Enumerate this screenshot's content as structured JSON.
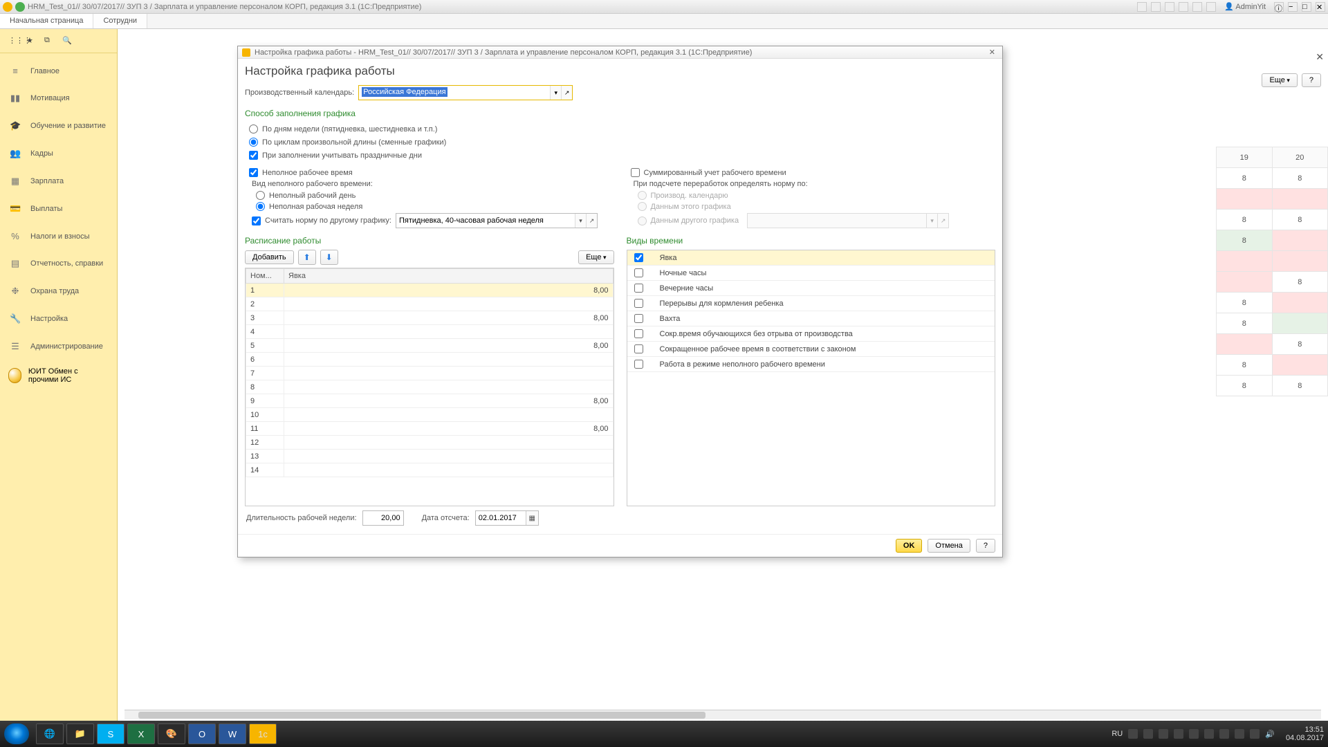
{
  "titlebar": {
    "text": "HRM_Test_01// 30/07/2017// ЗУП 3 / Зарплата и управление персоналом КОРП, редакция 3.1  (1С:Предприятие)",
    "user": "AdminYit"
  },
  "tabs": {
    "t0": "Начальная страница",
    "t1": "Сотрудни"
  },
  "sidebar": {
    "items": [
      "Главное",
      "Мотивация",
      "Обучение и развитие",
      "Кадры",
      "Зарплата",
      "Выплаты",
      "Налоги и взносы",
      "Отчетность, справки",
      "Охрана труда",
      "Настройка",
      "Администрирование"
    ],
    "yuit": "ЮИТ Обмен с прочими ИС"
  },
  "content": {
    "more": "Еще",
    "help": "?"
  },
  "modal": {
    "title": "Настройка графика работы - HRM_Test_01// 30/07/2017// ЗУП 3 / Зарплата и управление персоналом КОРП, редакция 3.1  (1С:Предприятие)",
    "h1": "Настройка графика работы",
    "calendar_label": "Производственный календарь:",
    "calendar_value": "Российская Федерация",
    "sect_fill": "Способ заполнения графика",
    "radio_bydays": "По дням недели (пятидневка, шестидневка и т.п.)",
    "radio_bycycles": "По циклам произвольной длины (сменные графики)",
    "chk_holidays": "При заполнении учитывать праздничные дни",
    "chk_parttime": "Неполное рабочее время",
    "chk_summ": "Суммированный учет рабочего времени",
    "pt_kind_label": "Вид неполного рабочего времени:",
    "pt_kind_day": "Неполный рабочий день",
    "pt_kind_week": "Неполная рабочая неделя",
    "chk_normother": "Считать норму по другому графику:",
    "norm_value": "Пятидневка, 40-часовая рабочая неделя",
    "norm_by_label": "При подсчете переработок определять норму по:",
    "norm_by_cal": "Производ. календарю",
    "norm_by_this": "Данным этого графика",
    "norm_by_other": "Данным другого графика",
    "sect_sched": "Расписание работы",
    "btn_add": "Добавить",
    "btn_more": "Еще",
    "col_num": "Ном...",
    "col_att": "Явка",
    "rows": [
      {
        "n": "1",
        "v": "8,00"
      },
      {
        "n": "2",
        "v": ""
      },
      {
        "n": "3",
        "v": "8,00"
      },
      {
        "n": "4",
        "v": ""
      },
      {
        "n": "5",
        "v": "8,00"
      },
      {
        "n": "6",
        "v": ""
      },
      {
        "n": "7",
        "v": ""
      },
      {
        "n": "8",
        "v": ""
      },
      {
        "n": "9",
        "v": "8,00"
      },
      {
        "n": "10",
        "v": ""
      },
      {
        "n": "11",
        "v": "8,00"
      },
      {
        "n": "12",
        "v": ""
      },
      {
        "n": "13",
        "v": ""
      },
      {
        "n": "14",
        "v": ""
      }
    ],
    "sect_types": "Виды времени",
    "types": [
      {
        "label": "Явка",
        "checked": true
      },
      {
        "label": "Ночные часы",
        "checked": false
      },
      {
        "label": "Вечерние часы",
        "checked": false
      },
      {
        "label": "Перерывы для кормления ребенка",
        "checked": false
      },
      {
        "label": "Вахта",
        "checked": false
      },
      {
        "label": "Сокр.время обучающихся без отрыва от производства",
        "checked": false
      },
      {
        "label": "Сокращенное рабочее время в соответствии с законом",
        "checked": false
      },
      {
        "label": "Работа в режиме неполного рабочего времени",
        "checked": false
      }
    ],
    "weeklen_label": "Длительность рабочей недели:",
    "weeklen_value": "20,00",
    "startdate_label": "Дата отсчета:",
    "startdate_value": "02.01.2017",
    "btn_ok": "OK",
    "btn_cancel": "Отмена",
    "btn_help": "?"
  },
  "bg_grid": {
    "cols": [
      "19",
      "20"
    ],
    "cells": [
      [
        "8",
        "8"
      ],
      [
        "",
        ""
      ],
      [
        "8",
        "8"
      ],
      [
        "8",
        ""
      ],
      [
        "",
        ""
      ],
      [
        "",
        "8"
      ],
      [
        "8",
        ""
      ],
      [
        "8",
        ""
      ],
      [
        "",
        "8"
      ],
      [
        "8",
        ""
      ],
      [
        "8",
        "8"
      ]
    ],
    "pinks": [
      [
        1,
        0
      ],
      [
        1,
        1
      ],
      [
        3,
        1
      ],
      [
        4,
        0
      ],
      [
        4,
        1
      ],
      [
        5,
        0
      ],
      [
        6,
        1
      ],
      [
        8,
        0
      ],
      [
        9,
        1
      ]
    ],
    "greens": [
      [
        7,
        1
      ],
      [
        3,
        0
      ]
    ]
  },
  "tray": {
    "lang": "RU",
    "time": "13:51",
    "date": "04.08.2017"
  }
}
